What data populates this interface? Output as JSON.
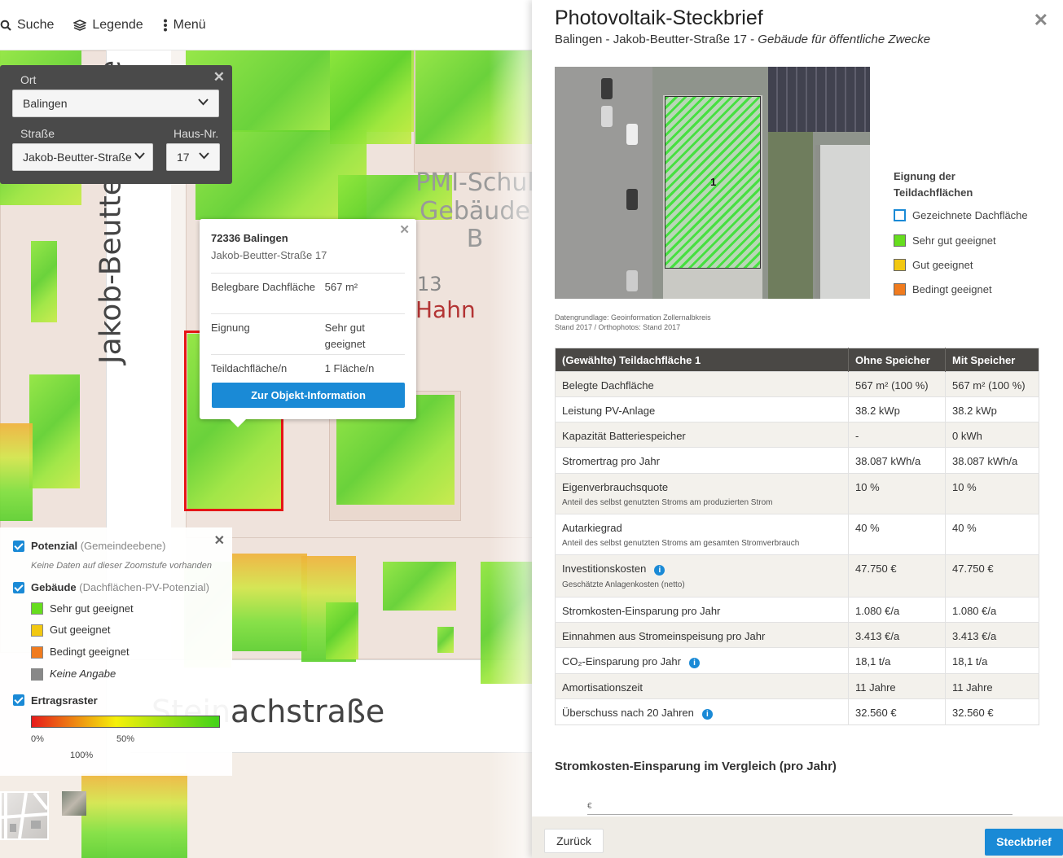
{
  "topbar": {
    "search_label": "Suche",
    "legend_label": "Legende",
    "menu_label": "Menü"
  },
  "location_box": {
    "ort_label": "Ort",
    "ort_value": "Balingen",
    "strasse_label": "Straße",
    "strasse_value": "Jakob-Beutter-Straße",
    "hausnr_label": "Haus-Nr.",
    "hausnr_value": "17"
  },
  "map": {
    "street_vertical": "Jakob-Beutter-Straße",
    "street_horizontal": "Steinachstraße",
    "poi_label": "PMI-Schul\nGebäude\nB",
    "house_number": "13",
    "hahn_label": "Hahn"
  },
  "popup": {
    "title": "72336 Balingen",
    "address": "Jakob-Beutter-Straße 17",
    "rows": [
      {
        "key": "Belegbare Dachfläche",
        "value": "567 m²"
      },
      {
        "key": "Eignung",
        "value": "Sehr gut geeignet"
      },
      {
        "key": "Teildachfläche/n",
        "value": "1 Fläche/n"
      }
    ],
    "button_label": "Zur Objekt-Information"
  },
  "legend": {
    "potenzial_label": "Potenzial",
    "potenzial_sub": "(Gemeindeebene)",
    "potenzial_note": "Keine Daten auf dieser Zoomstufe vorhanden",
    "gebaeude_label": "Gebäude",
    "gebaeude_sub": "(Dachflächen-PV-Potenzial)",
    "items": [
      {
        "label": "Sehr gut geeignet",
        "color": "#66dd1e"
      },
      {
        "label": "Gut geeignet",
        "color": "#f2c811"
      },
      {
        "label": "Bedingt geeignet",
        "color": "#f07b1e"
      },
      {
        "label": "Keine Angabe",
        "color": "#888888"
      }
    ],
    "ertragsraster_label": "Ertragsraster",
    "scale_0": "0%",
    "scale_50": "50%",
    "scale_100": "100%"
  },
  "panel": {
    "title": "Photovoltaik-Steckbrief",
    "subtitle_location": "Balingen - Jakob-Beutter-Straße 17 -",
    "subtitle_type": "Gebäude für öffentliche Zwecke",
    "roof_label": "1",
    "legend_title_1": "Eignung der",
    "legend_title_2": "Teildachflächen",
    "legend_items": [
      {
        "label": "Gezeichnete Dachfläche",
        "color": "#ffffff",
        "border": "#1a8ad6"
      },
      {
        "label": "Sehr gut geeignet",
        "color": "#66dd1e",
        "border": "#555555"
      },
      {
        "label": "Gut geeignet",
        "color": "#f2c811",
        "border": "#555555"
      },
      {
        "label": "Bedingt geeignet",
        "color": "#f07b1e",
        "border": "#555555"
      }
    ],
    "credit_1": "Datengrundlage: Geoinformation Zollernalbkreis",
    "credit_2": "Stand 2017 / Orthophotos: Stand 2017",
    "table": {
      "headers": [
        "(Gewählte) Teildachfläche 1",
        "Ohne Speicher",
        "Mit Speicher"
      ],
      "rows": [
        {
          "label": "Belegte Dachfläche",
          "sub": "",
          "info": false,
          "ohne": "567 m² (100 %)",
          "mit": "567 m² (100 %)"
        },
        {
          "label": "Leistung PV-Anlage",
          "sub": "",
          "info": false,
          "ohne": "38.2 kWp",
          "mit": "38.2 kWp"
        },
        {
          "label": "Kapazität Batteriespeicher",
          "sub": "",
          "info": false,
          "ohne": "-",
          "mit": "0 kWh"
        },
        {
          "label": "Stromertrag pro Jahr",
          "sub": "",
          "info": false,
          "ohne": "38.087 kWh/a",
          "mit": "38.087 kWh/a"
        },
        {
          "label": "Eigenverbrauchsquote",
          "sub": "Anteil des selbst genutzten Stroms am produzierten Strom",
          "info": false,
          "ohne": "10 %",
          "mit": "10 %"
        },
        {
          "label": "Autarkiegrad",
          "sub": "Anteil des selbst genutzten Stroms am gesamten Stromverbrauch",
          "info": false,
          "ohne": "40 %",
          "mit": "40 %"
        },
        {
          "label": "Investitionskosten",
          "sub": "Geschätzte Anlagenkosten (netto)",
          "info": true,
          "ohne": "47.750 €",
          "mit": "47.750 €"
        },
        {
          "label": "Stromkosten-Einsparung pro Jahr",
          "sub": "",
          "info": false,
          "ohne": "1.080 €/a",
          "mit": "1.080 €/a"
        },
        {
          "label": "Einnahmen aus Stromeinspeisung pro Jahr",
          "sub": "",
          "info": false,
          "ohne": "3.413 €/a",
          "mit": "3.413 €/a"
        },
        {
          "label": "CO₂-Einsparung pro Jahr",
          "sub": "",
          "info": true,
          "ohne": "18,1 t/a",
          "mit": "18,1 t/a"
        },
        {
          "label": "Amortisationszeit",
          "sub": "",
          "info": false,
          "ohne": "11 Jahre",
          "mit": "11 Jahre"
        },
        {
          "label": "Überschuss nach 20 Jahren",
          "sub": "",
          "info": true,
          "ohne": "32.560 €",
          "mit": "32.560 €"
        }
      ]
    },
    "section_heading": "Stromkosten-Einsparung im Vergleich (pro Jahr)",
    "chart_unit": "€",
    "back_label": "Zurück",
    "steckbrief_label": "Steckbrief"
  },
  "colors": {
    "accent": "#1a8ad6",
    "selection": "#e51616",
    "table_header": "#4a4845"
  }
}
